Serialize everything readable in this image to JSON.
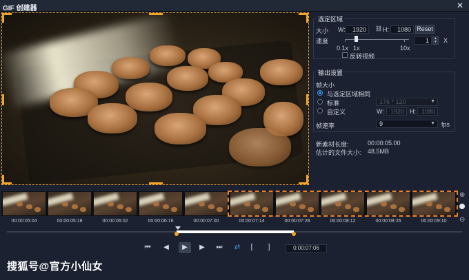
{
  "window": {
    "title": "GIF 创建器",
    "close_icon": "✕"
  },
  "selection": {
    "title": "选定区域",
    "size_label": "大小",
    "w_label": "W:",
    "w_value": "1920",
    "h_label": "H:",
    "h_value": "1080",
    "reset_label": "Reset",
    "speed_label": "速度",
    "speed_ticks": [
      "0.1x",
      "1x",
      "10x"
    ],
    "speed_value": "1",
    "speed_unit": "X",
    "reverse_label": "反转视频"
  },
  "output": {
    "title": "输出设置",
    "frame_size_label": "帧大小",
    "opt_same": "与选定区域相同",
    "opt_standard": "标准",
    "standard_value": "176 * 120",
    "opt_custom": "自定义",
    "w_label": "W:",
    "w_value": "1920",
    "h_label": "H:",
    "h_value": "1080",
    "fps_label": "帧速率",
    "fps_value": "9",
    "fps_unit": "fps"
  },
  "info": {
    "length_label": "新素材长度:",
    "length_value": "00:00:05.00",
    "size_label": "估计的文件大小:",
    "size_value": "48.5MB"
  },
  "timeline": {
    "times": [
      "00:00:05:04",
      "00:00:05:18",
      "00:00:06:02",
      "00:00:06:16",
      "00:00:07:00",
      "00:00:07:14",
      "00:00:07:28",
      "00:00:08:12",
      "00:00:08:26",
      "00:00:09:10"
    ],
    "zoom_in_icon": "⊕",
    "zoom_out_icon": "⊖"
  },
  "transport": {
    "first": "⏮",
    "prev": "◀",
    "play": "▶",
    "next": "▶",
    "last": "⏭",
    "loop": "⇄",
    "mark_in": "[",
    "mark_out": "]",
    "timecode": "0:00:07:06"
  },
  "watermark": "搜狐号@官方小仙女",
  "colors": {
    "accent": "#f0a52a",
    "selection_dash": "#e8822a",
    "radio_on": "#3fa1f2"
  }
}
